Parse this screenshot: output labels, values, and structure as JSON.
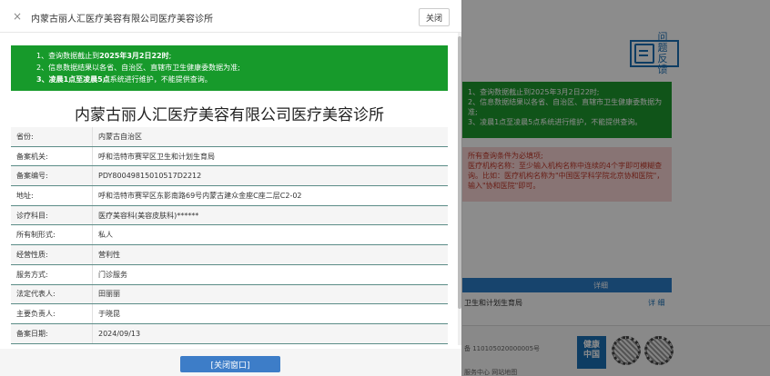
{
  "modal": {
    "title": "内蒙古丽人汇医疗美容有限公司医疗美容诊所",
    "close_icon": "×",
    "close_button": "关闭",
    "notice_lines": [
      "1、查询数据截止到2025年3月2日22时;",
      "2、信息数据结果以各省、自治区、直辖市卫生健康委数据为准;",
      "3、凌晨1点至凌晨5点系统进行维护，不能提供查询。"
    ],
    "company_name": "内蒙古丽人汇医疗美容有限公司医疗美容诊所",
    "fields": [
      {
        "label": "省份:",
        "value": "内蒙古自治区"
      },
      {
        "label": "备案机关:",
        "value": "呼和浩特市赛罕区卫生和计划生育局"
      },
      {
        "label": "备案编号:",
        "value": "PDY80049815010517D2212"
      },
      {
        "label": "地址:",
        "value": "呼和浩特市赛罕区东影南路69号内蒙古建众金座C座二层C2-02"
      },
      {
        "label": "诊疗科目:",
        "value": "医疗美容科(美容皮肤科)******"
      },
      {
        "label": "所有制形式:",
        "value": "私人"
      },
      {
        "label": "经营性质:",
        "value": "营利性"
      },
      {
        "label": "服务方式:",
        "value": "门诊服务"
      },
      {
        "label": "法定代表人:",
        "value": "田丽丽"
      },
      {
        "label": "主要负责人:",
        "value": "于晓昆"
      },
      {
        "label": "备案日期:",
        "value": "2024/09/13"
      }
    ],
    "close_window_button": "[关闭窗口]"
  },
  "background": {
    "feedback_label_1": "问题",
    "feedback_label_2": "反馈",
    "notice_lines": [
      "1、查询数据截止到2025年3月2日22时;",
      "2、信息数据结果以各省、自治区、直辖市卫生健康委数据为准;",
      "3、凌晨1点至凌晨5点系统进行维护，不能提供查询。"
    ],
    "requirement_lines": [
      "所有查询条件为必填项;",
      "医疗机构名称：至少输入机构名称中连续的4个字即可模糊查询。比如：医疗机构名称为\"中国医学科学院北京协和医院\"，输入\"协和医院\"即可。"
    ],
    "table_header": "详细",
    "table_row_text": "卫生和计划生育局",
    "table_row_link": "详 细",
    "footer_record": "备 110105020000005号",
    "footer_links": "服务中心   网站地图",
    "health_badge_1": "健康",
    "health_badge_2": "中国"
  },
  "colors": {
    "notice_green": "#179a2b",
    "button_blue": "#3d7dc8",
    "row_border": "#5b8c87"
  }
}
